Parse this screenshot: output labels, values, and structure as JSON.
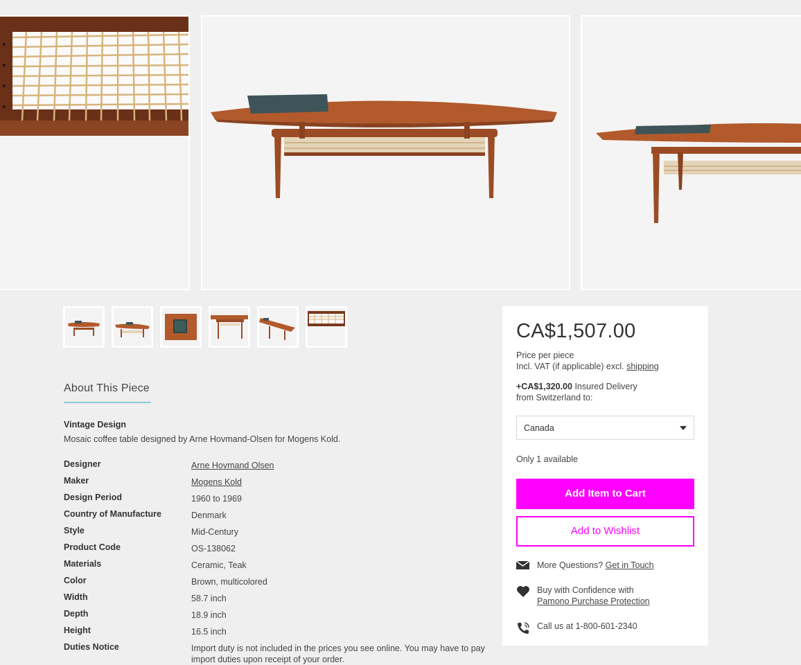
{
  "gallery": {
    "slides": [
      "table-caning-closeup",
      "table-front-view",
      "table-side-view"
    ],
    "thumbnails": [
      "thumb-front",
      "thumb-angle",
      "thumb-mosaic",
      "thumb-side",
      "thumb-perspective",
      "thumb-caning"
    ]
  },
  "about": {
    "title": "About This Piece",
    "heading": "Vintage Design",
    "description": "Mosaic coffee table designed by Arne Hovmand-Olsen for Mogens Kold."
  },
  "specs": [
    {
      "label": "Designer",
      "value": "Arne Hovmand Olsen"
    },
    {
      "label": "Maker",
      "value": "Mogens Kold"
    },
    {
      "label": "Design Period",
      "value": "1960 to 1969"
    },
    {
      "label": "Country of Manufacture",
      "value": "Denmark"
    },
    {
      "label": "Style",
      "value": "Mid-Century"
    },
    {
      "label": "Product Code",
      "value": "OS-138062"
    },
    {
      "label": "Materials",
      "value": "Ceramic, Teak"
    },
    {
      "label": "Color",
      "value": "Brown, multicolored"
    },
    {
      "label": "Width",
      "value": "58.7 inch"
    },
    {
      "label": "Depth",
      "value": "18.9 inch"
    },
    {
      "label": "Height",
      "value": "16.5 inch"
    },
    {
      "label": "Duties Notice",
      "value": "Import duty is not included in the prices you see online. You may have to pay import duties upon receipt of your order."
    }
  ],
  "purchase": {
    "price": "CA$1,507.00",
    "price_per": "Price per piece",
    "vat_prefix": "Incl. VAT (if applicable) excl.",
    "shipping_link": "shipping",
    "delivery_price": "+CA$1,320.00",
    "delivery_label": "Insured Delivery",
    "delivery_from": "from Switzerland to:",
    "country": "Canada",
    "availability": "Only 1 available",
    "cart_button": "Add Item to Cart",
    "wishlist_button": "Add to Wishlist",
    "questions_prefix": "More Questions?",
    "questions_link": "Get in Touch",
    "confidence_prefix": "Buy with Confidence with",
    "confidence_link": "Pamono Purchase Protection",
    "call_text": "Call us at 1-800-601-2340"
  },
  "colors": {
    "accent": "#ff00ff",
    "underline": "#8ccbd6",
    "background": "#efefef"
  }
}
